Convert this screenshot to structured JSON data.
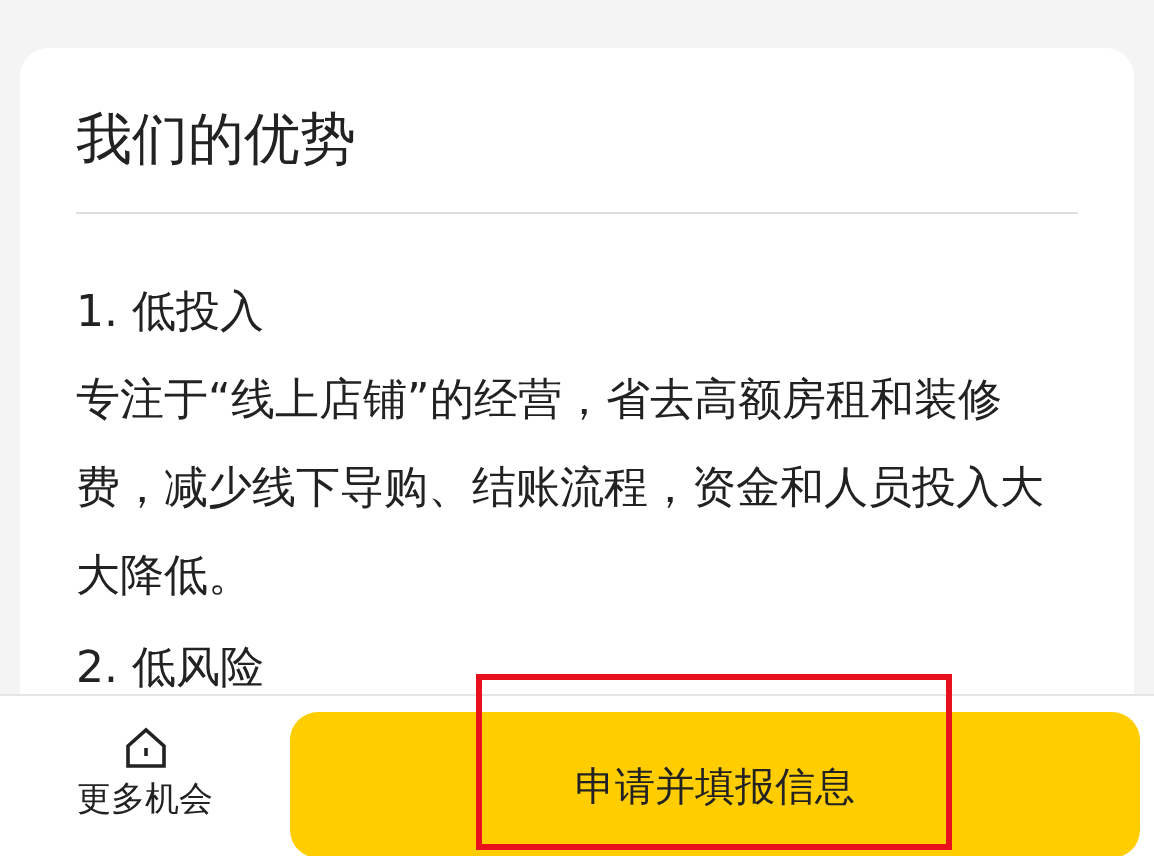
{
  "section": {
    "title": "我们的优势",
    "items": [
      {
        "heading": "1. 低投入",
        "text": "专注于“线上店铺”的经营，省去高额房租和装修费，减少线下导购、结账流程，资金和人员投入大大降低。"
      },
      {
        "heading": "2. 低风险"
      }
    ]
  },
  "bottom_bar": {
    "more_label": "更多机会",
    "apply_button": "申请并填报信息"
  }
}
